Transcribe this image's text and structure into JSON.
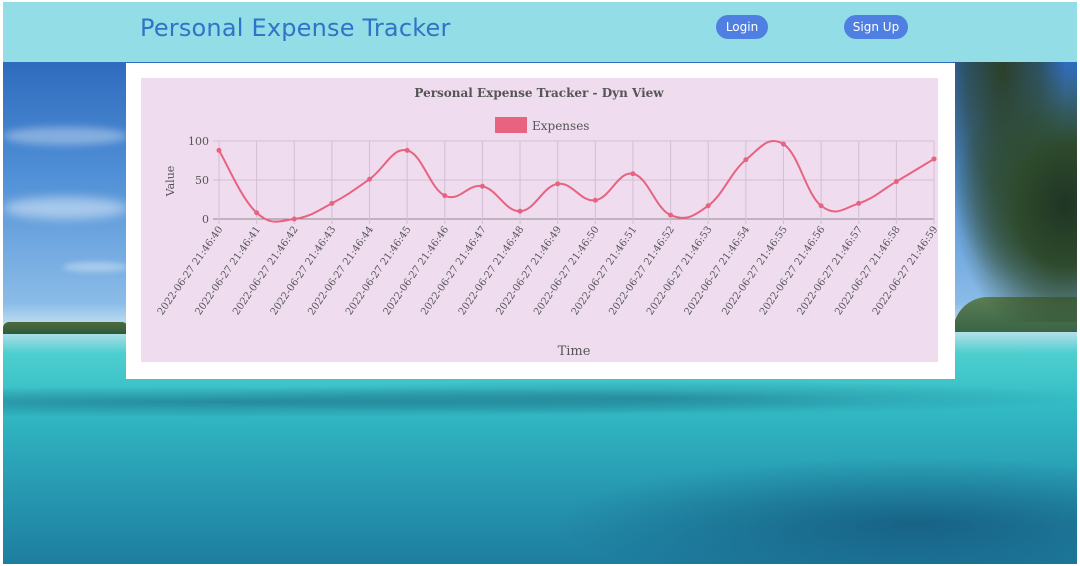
{
  "header": {
    "title": "Personal Expense Tracker",
    "login_label": "Login",
    "signup_label": "Sign Up"
  },
  "colors": {
    "header_bg": "#93dde6",
    "title": "#2f74c7",
    "button": "#4f7fe0",
    "chart_bg": "#efdcef",
    "series": "#e8637f"
  },
  "chart_data": {
    "type": "line",
    "title": "Personal Expense Tracker - Dyn View",
    "xlabel": "Time",
    "ylabel": "Value",
    "ylim": [
      0,
      100
    ],
    "yticks": [
      0,
      50,
      100
    ],
    "grid": true,
    "legend": "top",
    "x": [
      "2022-06-27 21:46:40",
      "2022-06-27 21:46:41",
      "2022-06-27 21:46:42",
      "2022-06-27 21:46:43",
      "2022-06-27 21:46:44",
      "2022-06-27 21:46:45",
      "2022-06-27 21:46:46",
      "2022-06-27 21:46:47",
      "2022-06-27 21:46:48",
      "2022-06-27 21:46:49",
      "2022-06-27 21:46:50",
      "2022-06-27 21:46:51",
      "2022-06-27 21:46:52",
      "2022-06-27 21:46:53",
      "2022-06-27 21:46:54",
      "2022-06-27 21:46:55",
      "2022-06-27 21:46:56",
      "2022-06-27 21:46:57",
      "2022-06-27 21:46:58",
      "2022-06-27 21:46:59"
    ],
    "series": [
      {
        "name": "Expenses",
        "values": [
          88,
          8,
          0,
          20,
          51,
          88,
          30,
          42,
          10,
          45,
          24,
          58,
          5,
          17,
          76,
          96,
          17,
          20,
          48,
          77
        ]
      }
    ]
  }
}
